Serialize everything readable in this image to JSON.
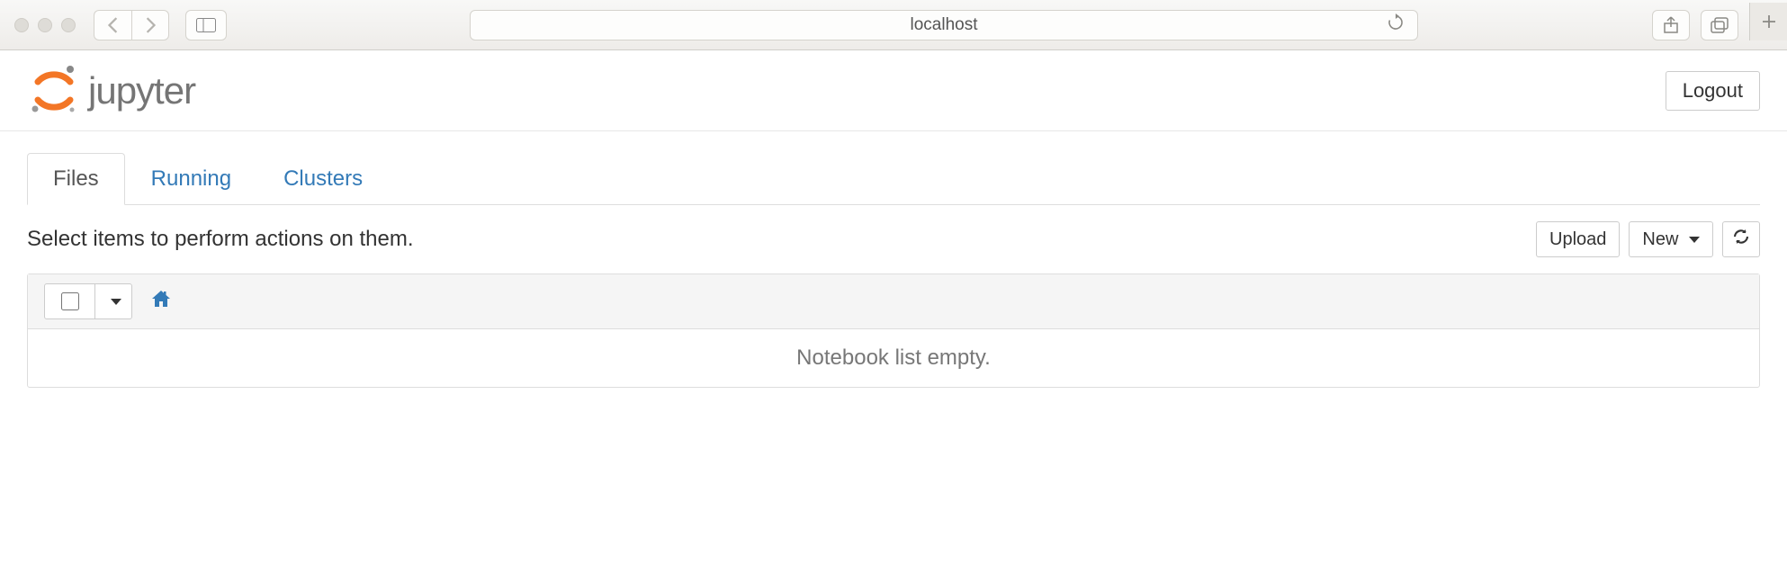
{
  "browser": {
    "url": "localhost"
  },
  "header": {
    "logo_text": "jupyter",
    "logout_label": "Logout"
  },
  "tabs": [
    {
      "label": "Files",
      "active": true
    },
    {
      "label": "Running",
      "active": false
    },
    {
      "label": "Clusters",
      "active": false
    }
  ],
  "actions": {
    "hint": "Select items to perform actions on them.",
    "upload_label": "Upload",
    "new_label": "New"
  },
  "list": {
    "empty_message": "Notebook list empty."
  }
}
